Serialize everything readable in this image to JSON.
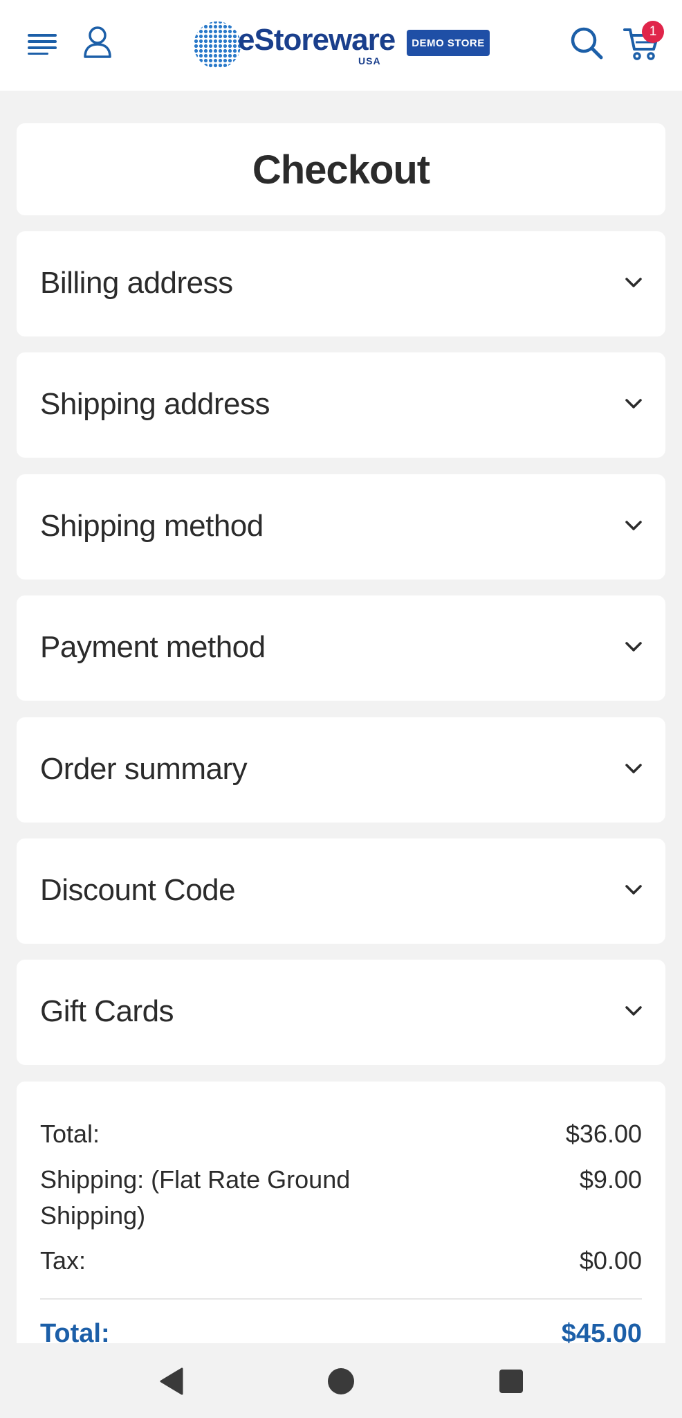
{
  "header": {
    "menu_icon": "hamburger-menu-icon",
    "account_icon": "user-icon",
    "logo": {
      "brand": "eStoreware",
      "sub": "USA",
      "badge": "DEMO STORE"
    },
    "search_icon": "search-icon",
    "cart_icon": "cart-icon",
    "cart_count": "1"
  },
  "page": {
    "title": "Checkout"
  },
  "sections": [
    {
      "label": "Billing address"
    },
    {
      "label": "Shipping address"
    },
    {
      "label": "Shipping method"
    },
    {
      "label": "Payment method"
    },
    {
      "label": "Order summary"
    },
    {
      "label": "Discount Code"
    },
    {
      "label": "Gift Cards"
    }
  ],
  "totals": {
    "subtotal_label": "Total:",
    "subtotal_value": "$36.00",
    "shipping_label_line1": "Shipping: (Flat Rate Ground",
    "shipping_label_line2": "Shipping)",
    "shipping_value": "$9.00",
    "tax_label": "Tax:",
    "tax_value": "$0.00",
    "grand_label": "Total:",
    "grand_value": "$45.00"
  },
  "navbar": {
    "back_icon": "back-triangle-icon",
    "home_icon": "home-circle-icon",
    "recents_icon": "recents-square-icon"
  },
  "colors": {
    "accent": "#1c5fa8",
    "brand_navy": "#1a3f8c",
    "badge_red": "#e0254a",
    "page_bg": "#f2f2f2"
  }
}
